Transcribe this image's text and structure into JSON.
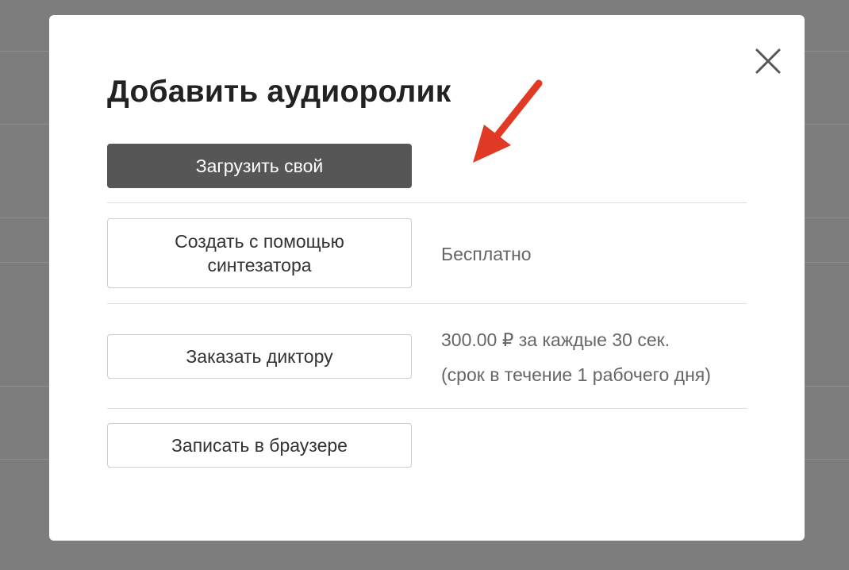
{
  "modal": {
    "title": "Добавить аудиоролик",
    "options": [
      {
        "label": "Загрузить свой",
        "primary": true
      },
      {
        "label": "Создать с помощью синтезатора",
        "note": "Бесплатно"
      },
      {
        "label": "Заказать диктору",
        "note_line1": "300.00 ₽ за каждые 30 сек.",
        "note_line2": "(срок в течение 1 рабочего дня)"
      },
      {
        "label": "Записать в браузере"
      }
    ]
  },
  "icons": {
    "close": "close-icon",
    "annotation": "red-arrow-annotation"
  },
  "colors": {
    "backdrop": "#7d7d7d",
    "primary_button": "#565656",
    "arrow": "#e03a24"
  }
}
